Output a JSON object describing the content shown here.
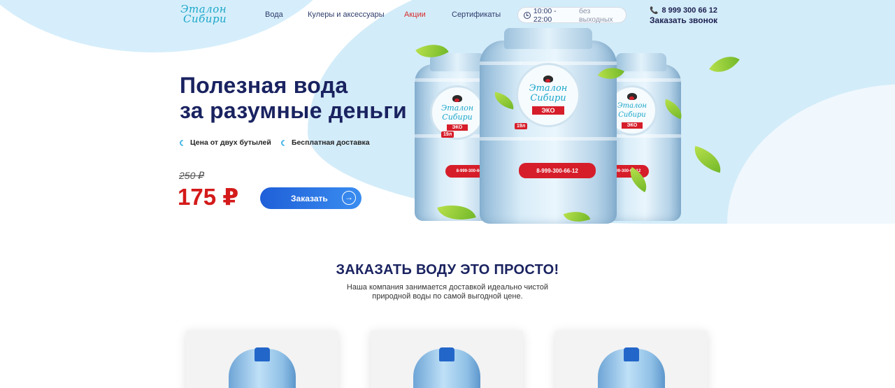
{
  "header": {
    "logo": [
      "Эталон",
      "Сибири"
    ],
    "nav": [
      {
        "label": "Вода",
        "active": false
      },
      {
        "label": "Кулеры и аксессуары",
        "active": false
      },
      {
        "label": "Акции",
        "active": true
      },
      {
        "label": "Сертификаты",
        "active": false
      }
    ],
    "hours_time": "10:00 - 22:00",
    "hours_days": "без выходных",
    "phone": "8 999 300 66 12",
    "callback": "Заказать звонок"
  },
  "hero": {
    "title_line1": "Полезная вода",
    "title_line2": "за разумные деньги",
    "features": [
      "Цена от двух бутылей",
      "Бесплатная доставка"
    ],
    "old_price": "250 ₽",
    "new_price": "175 ₽",
    "order_label": "Заказать"
  },
  "bottle_label": {
    "name": [
      "Эталон",
      "Сибири"
    ],
    "eco": "ЭКО",
    "phone": "8-999-300-66-12",
    "volume": "19л"
  },
  "steps": {
    "title": "ЗАКАЗАТЬ ВОДУ ЭТО ПРОСТО!",
    "subtitle_line1": "Наша компания занимается доставкой идеально чистой",
    "subtitle_line2": "природной воды по самой выгодной цене."
  },
  "colors": {
    "accent_blue": "#2a6fe0",
    "price_red": "#d41a1a",
    "navy": "#1a2360",
    "promo_red": "#d62b2b"
  }
}
